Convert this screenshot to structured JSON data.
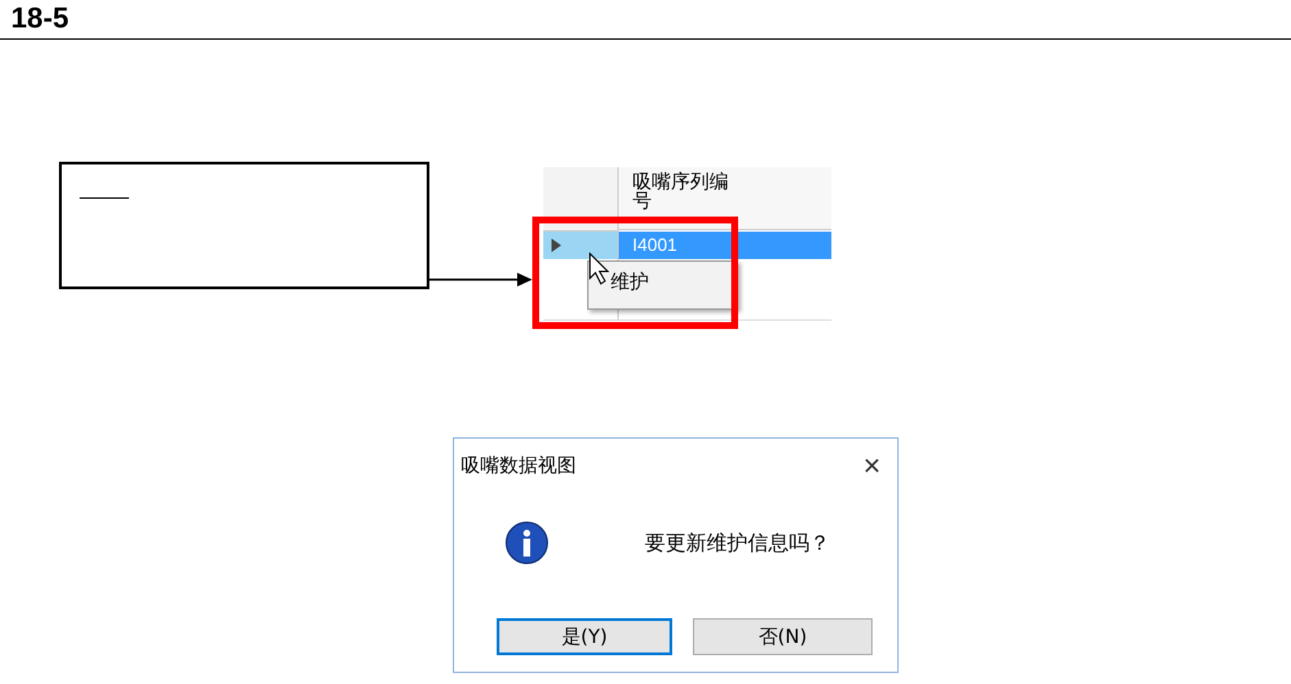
{
  "heading": "18-5",
  "grid": {
    "header": "吸嘴序列编号",
    "rows": [
      {
        "value": "I4001",
        "selected": true
      }
    ]
  },
  "context_menu": {
    "items": [
      "维护"
    ]
  },
  "dialog": {
    "title": "吸嘴数据视图",
    "close": "×",
    "message": "要更新维护信息吗？",
    "buttons": [
      {
        "label": "是(Y)",
        "selected": true
      },
      {
        "label": "否(N)",
        "selected": false
      }
    ]
  }
}
